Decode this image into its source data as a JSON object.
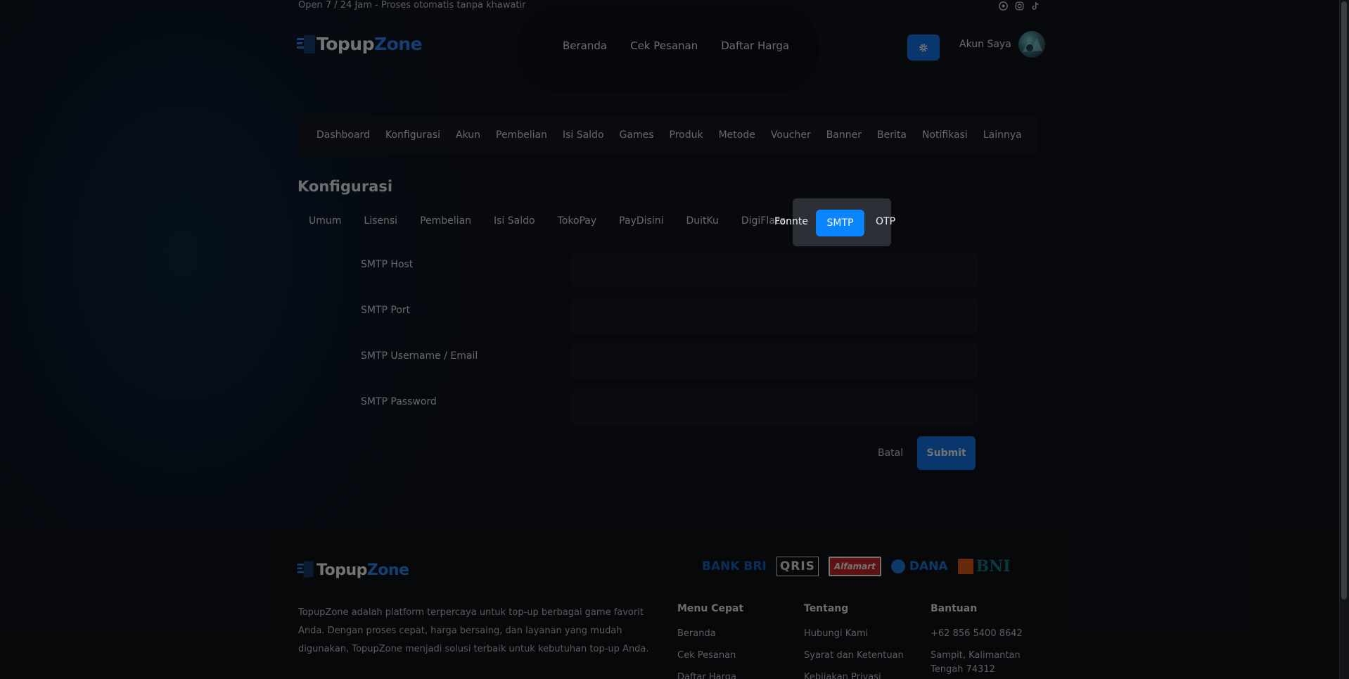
{
  "topbar": {
    "tagline": "Open 7 / 24 Jam - Proses otomatis tanpa khawatir",
    "social_icons": [
      "whatsapp-icon",
      "instagram-icon",
      "tiktok-icon"
    ]
  },
  "header": {
    "logo_part1": "Topup",
    "logo_part2": "Zone",
    "nav": [
      "Beranda",
      "Cek Pesanan",
      "Daftar Harga"
    ],
    "account_label": "Akun Saya"
  },
  "admin_nav": [
    "Dashboard",
    "Konfigurasi",
    "Akun",
    "Pembelian",
    "Isi Saldo",
    "Games",
    "Produk",
    "Metode",
    "Voucher",
    "Banner",
    "Berita",
    "Notifikasi",
    "Lainnya"
  ],
  "page": {
    "title": "Konfigurasi"
  },
  "tabs": {
    "items": [
      "Umum",
      "Lisensi",
      "Pembelian",
      "Isi Saldo",
      "TokoPay",
      "PayDisini",
      "DuitKu",
      "DigiFlazz"
    ],
    "fonnte": "Fonnte",
    "active": "SMTP",
    "otp": "OTP"
  },
  "form": {
    "fields": [
      {
        "label": "SMTP Host",
        "value": ""
      },
      {
        "label": "SMTP Port",
        "value": ""
      },
      {
        "label": "SMTP Username / Email",
        "value": ""
      },
      {
        "label": "SMTP Password",
        "value": ""
      }
    ],
    "cancel_label": "Batal",
    "submit_label": "Submit"
  },
  "footer": {
    "logo_part1": "Topup",
    "logo_part2": "Zone",
    "description": "TopupZone adalah platform terpercaya untuk top-up berbagai game favorit Anda. Dengan proses cepat, harga bersaing, dan layanan yang mudah digunakan, TopupZone menjadi solusi terbaik untuk kebutuhan top-up Anda.",
    "payments": [
      "BANK BRI",
      "QRIS",
      "Alfamart",
      "DANA",
      "BNI"
    ],
    "menu_cepat": {
      "title": "Menu Cepat",
      "links": [
        "Beranda",
        "Cek Pesanan",
        "Daftar Harga"
      ]
    },
    "tentang": {
      "title": "Tentang",
      "links": [
        "Hubungi Kami",
        "Syarat dan Ketentuan",
        "Kebijakan Privasi"
      ]
    },
    "bantuan": {
      "title": "Bantuan",
      "links": [
        "+62 856 5400 8642",
        "Sampit, Kalimantan Tengah 74312"
      ]
    }
  },
  "colors": {
    "accent": "#1478f0",
    "active_tab": "#0a84ff",
    "background": "#0f1219"
  }
}
